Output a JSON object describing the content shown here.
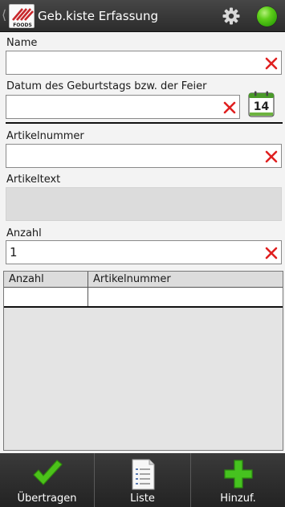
{
  "header": {
    "title": "Geb.kiste Erfassung",
    "back_icon": "chevron-left-icon",
    "logo_icon": "app-logo",
    "settings_icon": "gear-icon",
    "status_color": "#4cbf10"
  },
  "form": {
    "name": {
      "label": "Name",
      "value": ""
    },
    "datum": {
      "label": "Datum des Geburtstags bzw. der Feier",
      "value": "",
      "calendar_text": "14"
    },
    "artikelnummer": {
      "label": "Artikelnummer",
      "value": ""
    },
    "artikeltext": {
      "label": "Artikeltext",
      "value": ""
    },
    "anzahl": {
      "label": "Anzahl",
      "value": "1"
    }
  },
  "table": {
    "columns": [
      "Anzahl",
      "Artikelnummer"
    ],
    "rows": [
      [
        "",
        ""
      ]
    ]
  },
  "toolbar": {
    "transfer_label": "Übertragen",
    "list_label": "Liste",
    "add_label": "Hinzuf."
  },
  "colors": {
    "clear_x": "#e02020",
    "check_green": "#4cc21a",
    "plus_green": "#46c21f"
  }
}
